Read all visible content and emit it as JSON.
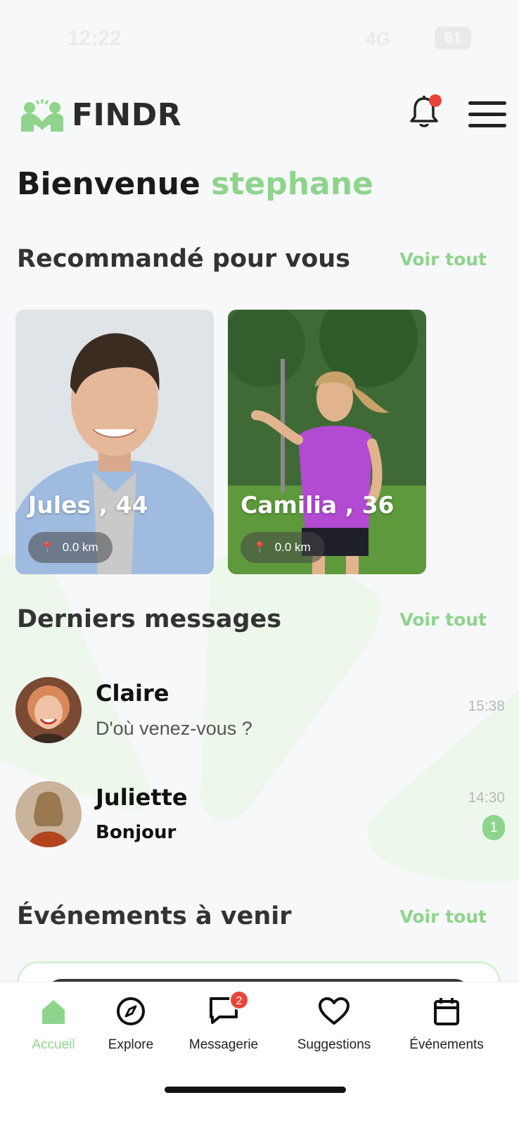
{
  "status_bar": {
    "time": "12:22",
    "signal": "4G",
    "battery": "61"
  },
  "app": {
    "name": "FINDR"
  },
  "welcome": {
    "prefix": "Bienvenue",
    "user": "stephane"
  },
  "recommended": {
    "title": "Recommandé pour vous",
    "see_all": "Voir tout",
    "profiles": [
      {
        "name": "Jules , 44",
        "distance": "0.0 km"
      },
      {
        "name": "Camilia , 36",
        "distance": "0.0 km"
      }
    ]
  },
  "messages": {
    "title": "Derniers messages",
    "see_all": "Voir tout",
    "items": [
      {
        "name": "Claire",
        "text": "D'où venez-vous ?",
        "time": "15:38",
        "unread": null
      },
      {
        "name": "Juliette",
        "text": "Bonjour",
        "time": "14:30",
        "unread": "1"
      }
    ]
  },
  "events": {
    "title": "Événements à venir",
    "see_all": "Voir tout"
  },
  "bottom_nav": {
    "items": [
      {
        "label": "Accueil",
        "icon": "home-icon",
        "active": true
      },
      {
        "label": "Explore",
        "icon": "compass-icon"
      },
      {
        "label": "Messagerie",
        "icon": "chat-icon",
        "badge": "2"
      },
      {
        "label": "Suggestions",
        "icon": "heart-icon"
      },
      {
        "label": "Événements",
        "icon": "calendar-icon"
      }
    ]
  },
  "colors": {
    "accent": "#8fd48d",
    "badge": "#e8453a",
    "text": "#1a1a1a"
  }
}
